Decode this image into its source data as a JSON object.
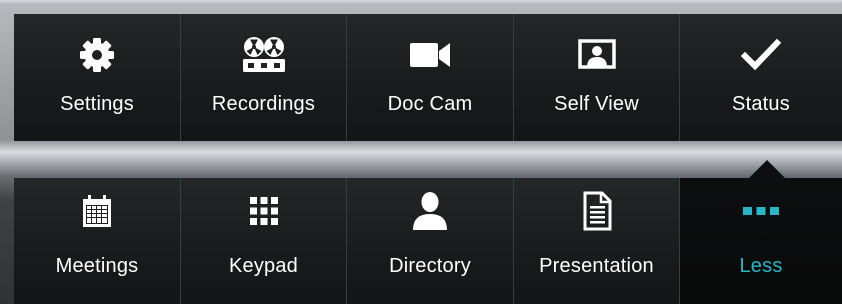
{
  "top_row": [
    {
      "label": "Settings",
      "icon": "gear-icon"
    },
    {
      "label": "Recordings",
      "icon": "recorder-icon"
    },
    {
      "label": "Doc Cam",
      "icon": "camera-icon"
    },
    {
      "label": "Self View",
      "icon": "self-view-icon"
    },
    {
      "label": "Status",
      "icon": "checkmark-icon"
    }
  ],
  "bottom_row": [
    {
      "label": "Meetings",
      "icon": "calendar-icon"
    },
    {
      "label": "Keypad",
      "icon": "keypad-icon"
    },
    {
      "label": "Directory",
      "icon": "person-icon"
    },
    {
      "label": "Presentation",
      "icon": "document-icon"
    },
    {
      "label": "Less",
      "icon": "more-dots-icon",
      "active": true
    }
  ],
  "colors": {
    "tile_bg": "#1a1b1d",
    "label": "#ffffff",
    "accent": "#27b7c6"
  }
}
